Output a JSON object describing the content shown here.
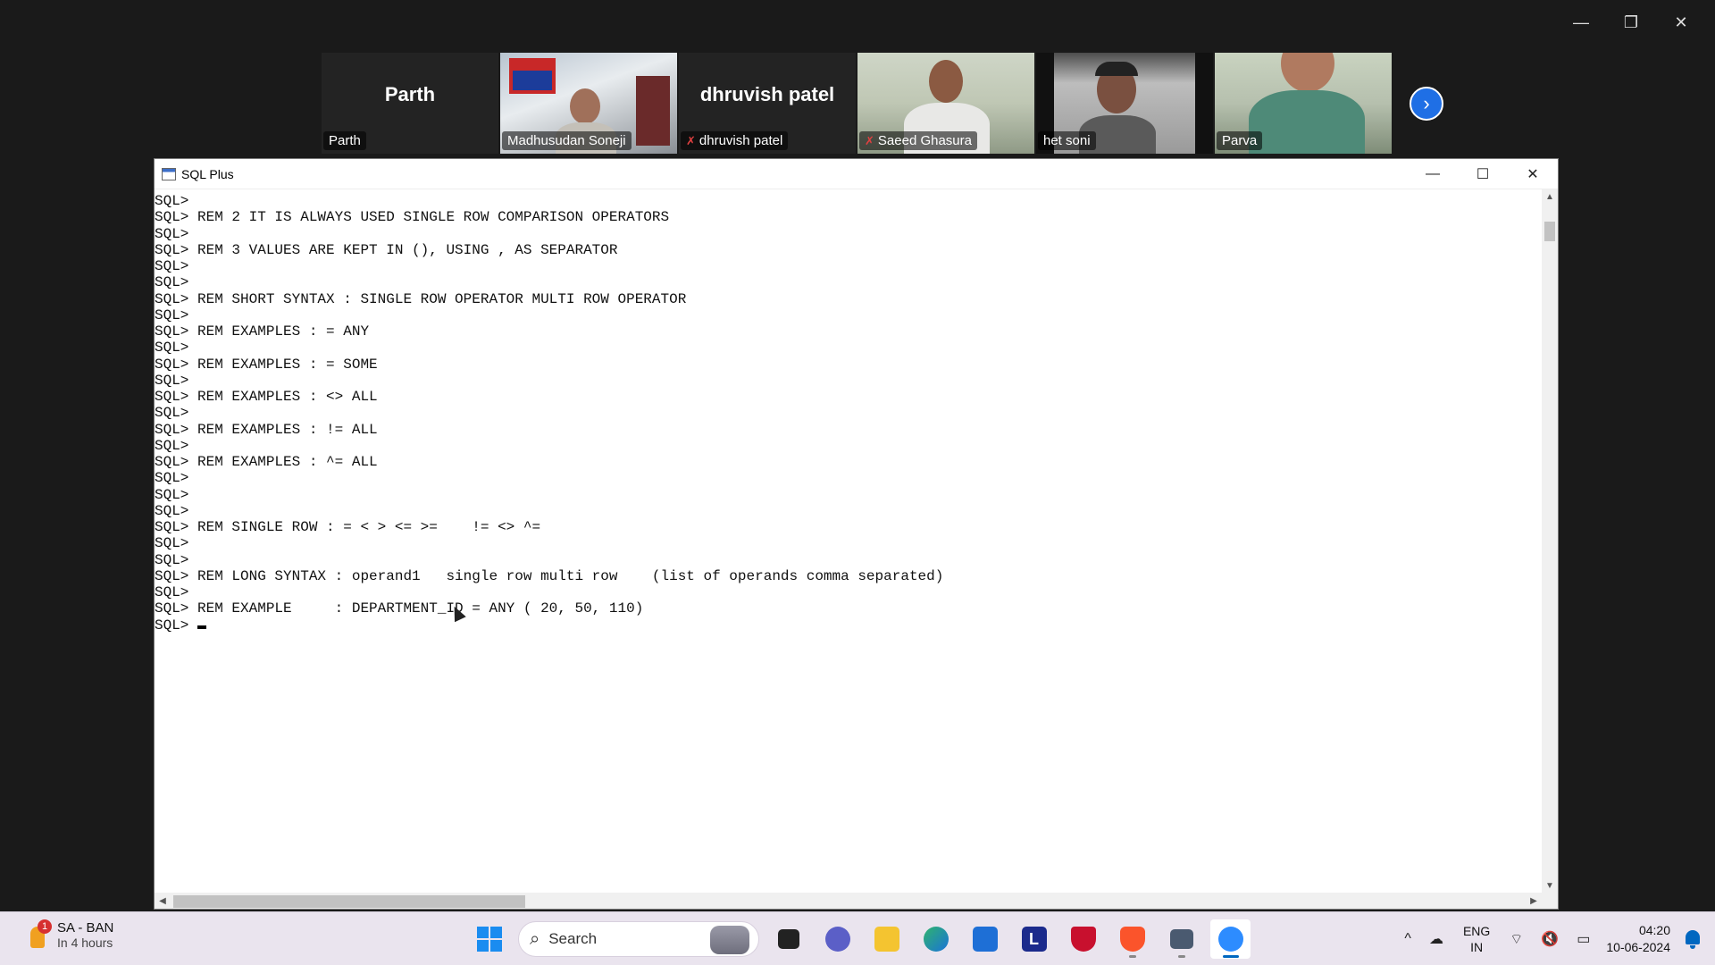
{
  "zoom_window": {
    "controls": [
      "—",
      "❐",
      "✕"
    ]
  },
  "participants": [
    {
      "display_name": "Parth",
      "label": "Parth",
      "type": "name",
      "muted": false
    },
    {
      "display_name": "",
      "label": "Madhusudan Soneji",
      "type": "video",
      "muted": false,
      "active": true
    },
    {
      "display_name": "dhruvish patel",
      "label": "dhruvish patel",
      "type": "name",
      "muted": true
    },
    {
      "display_name": "",
      "label": "Saeed Ghasura",
      "type": "video",
      "muted": true
    },
    {
      "display_name": "",
      "label": "het soni",
      "type": "video",
      "muted": false
    },
    {
      "display_name": "",
      "label": "Parva",
      "type": "video",
      "muted": false
    }
  ],
  "next_button": "›",
  "sqlplus": {
    "title": "SQL Plus",
    "controls": [
      "—",
      "☐",
      "✕"
    ],
    "lines": [
      "SQL>",
      "SQL> REM 2 IT IS ALWAYS USED SINGLE ROW COMPARISON OPERATORS",
      "SQL>",
      "SQL> REM 3 VALUES ARE KEPT IN (), USING , AS SEPARATOR",
      "SQL>",
      "SQL>",
      "SQL> REM SHORT SYNTAX : SINGLE ROW OPERATOR MULTI ROW OPERATOR",
      "SQL>",
      "SQL> REM EXAMPLES : = ANY",
      "SQL>",
      "SQL> REM EXAMPLES : = SOME",
      "SQL>",
      "SQL> REM EXAMPLES : <> ALL",
      "SQL>",
      "SQL> REM EXAMPLES : != ALL",
      "SQL>",
      "SQL> REM EXAMPLES : ^= ALL",
      "SQL>",
      "SQL>",
      "SQL>",
      "SQL> REM SINGLE ROW : = < > <= >=    != <> ^=",
      "SQL>",
      "SQL>",
      "SQL> REM LONG SYNTAX : operand1   single row multi row    (list of operands comma separated)",
      "SQL>",
      "SQL> REM EXAMPLE     : DEPARTMENT_ID = ANY ( 20, 50, 110)"
    ],
    "prompt": "SQL> "
  },
  "taskbar": {
    "weather": {
      "badge": "1",
      "title": "SA - BAN",
      "subtitle": "In 4 hours"
    },
    "search_placeholder": "Search",
    "apps": [
      "start",
      "search",
      "file-explorer",
      "teams-chat",
      "folder",
      "edge",
      "store",
      "l-app",
      "mcafee",
      "brave",
      "sqlplus",
      "zoom"
    ],
    "tray": {
      "chevron": "^",
      "cloud": "☁",
      "lang1": "ENG",
      "lang2": "IN",
      "wifi": "⌔",
      "volume": "🔇",
      "battery": "▭"
    },
    "time": "04:20",
    "date": "10-06-2024"
  }
}
